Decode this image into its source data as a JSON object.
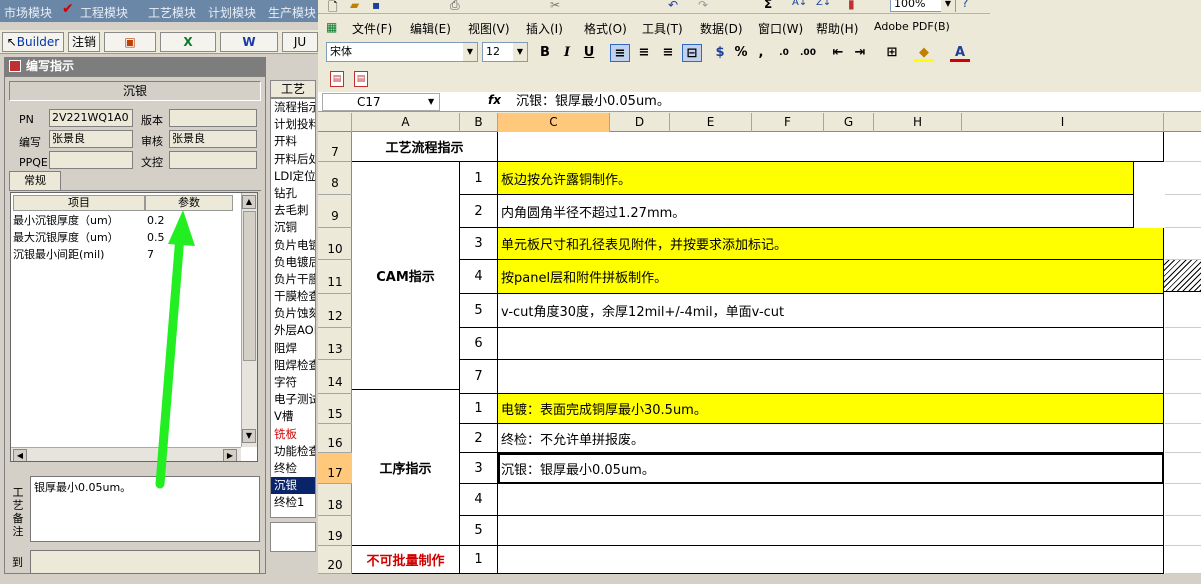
{
  "left_app": {
    "top_menu": [
      "市场模块",
      "工程模块",
      "工艺模块",
      "计划模块",
      "生产模块"
    ],
    "toolbar": {
      "builder": "Builder",
      "logout": "注销",
      "ju": "JU"
    },
    "panel_title": "编写指示",
    "process_name": "沉银",
    "fields": {
      "pn_label": "PN",
      "pn_value": "2V221WQ1A0",
      "version_label": "版本",
      "version_value": "",
      "author_label": "编写",
      "author_value": "张景良",
      "reviewer_label": "审核",
      "reviewer_value": "张景良",
      "ppqe_label": "PPQE",
      "ppqe_value": "",
      "control_label": "文控",
      "control_value": ""
    },
    "tab_general": "常规",
    "param_table": {
      "headers": [
        "项目",
        "参数"
      ],
      "rows": [
        {
          "item": "最小沉银厚度（um）",
          "value": "0.2"
        },
        {
          "item": "最大沉银厚度（um）",
          "value": "0.5"
        },
        {
          "item": "沉银最小间距(mil)",
          "value": "7"
        }
      ]
    },
    "remark_label": "工艺备注",
    "remark_text": "银厚最小0.05um。",
    "bottom_label": "到",
    "process_list_header": "工艺",
    "process_list": [
      "流程指示",
      "计划投料",
      "开料",
      "开料后处理",
      "LDI定位",
      "钻孔",
      "去毛刺",
      "沉铜",
      "负片电镀",
      "负电镀后",
      "负片干膜",
      "干膜检查",
      "负片蚀刻",
      "外层AOI",
      "阻焊",
      "阻焊检查",
      "字符",
      "电子测试",
      "V槽",
      "铣板",
      "功能检查",
      "终检",
      "沉银",
      "终检1"
    ],
    "process_selected": "沉银",
    "process_red": "铣板"
  },
  "excel": {
    "menu": [
      "文件(F)",
      "编辑(E)",
      "视图(V)",
      "插入(I)",
      "格式(O)",
      "工具(T)",
      "数据(D)",
      "窗口(W)",
      "帮助(H)",
      "Adobe PDF(B)"
    ],
    "font_name": "宋体",
    "font_size": "12",
    "zoom": "100%",
    "name_box": "C17",
    "fx": "fx",
    "formula": "沉银：银厚最小0.05um。",
    "columns": [
      "A",
      "B",
      "C",
      "D",
      "E",
      "F",
      "G",
      "H",
      "I"
    ],
    "rows": [
      "7",
      "8",
      "9",
      "10",
      "11",
      "12",
      "13",
      "14",
      "15",
      "16",
      "17",
      "18",
      "19",
      "20"
    ],
    "title_cell": "工艺流程指示",
    "cam_label": "CAM指示",
    "proc_label": "工序指示",
    "nobatch_label": "不可批量制作",
    "cam_items": [
      {
        "no": "1",
        "text": "板边按允许露铜制作。"
      },
      {
        "no": "2",
        "text": "内角圆角半径不超过1.27mm。"
      },
      {
        "no": "3",
        "text": "单元板尺寸和孔径表见附件，并按要求添加标记。"
      },
      {
        "no": "4",
        "text": "按panel层和附件拼板制作。"
      },
      {
        "no": "5",
        "text": "v-cut角度30度，余厚12mil+/-4mil，单面v-cut"
      },
      {
        "no": "6",
        "text": ""
      },
      {
        "no": "7",
        "text": ""
      }
    ],
    "proc_items": [
      {
        "no": "1",
        "text": "电镀：表面完成铜厚最小30.5um。"
      },
      {
        "no": "2",
        "text": "终检：不允许单拼报废。"
      },
      {
        "no": "3",
        "text": "沉银：银厚最小0.05um。"
      },
      {
        "no": "4",
        "text": ""
      },
      {
        "no": "5",
        "text": ""
      }
    ],
    "nobatch_no": "1"
  },
  "colors": {
    "highlight": "#ffff00",
    "selected_header": "#ffc87a",
    "arrow": "#22ee22",
    "list_selection": "#0a246a",
    "red_text": "#d00000"
  }
}
